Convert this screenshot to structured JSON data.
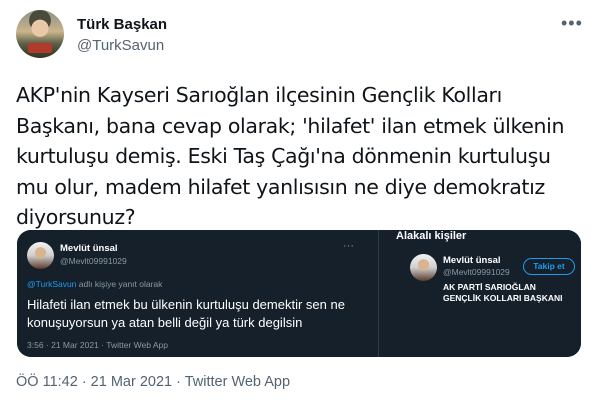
{
  "author": {
    "display_name": "Türk Başkan",
    "handle": "@TurkSavun",
    "more_icon": "more-horizontal-icon"
  },
  "tweet": {
    "text": "AKP'nin Kayseri Sarıoğlan ilçesinin Gençlik Kolları\nBaşkanı, bana cevap olarak;  'hilafet'  ilan etmek ülkenin\nkurtuluşu demiş.  Eski Taş Çağı'na dönmenin kurtuluşu\nmu olur, madem hilafet yanlısısın ne  diye demokratız\ndiyorsunuz?",
    "meta": "ÖÖ 11:42 · 21 Mar 2021 · Twitter Web App"
  },
  "screenshot": {
    "quoted": {
      "name": "Mevlüt ünsal",
      "handle": "@Mevlt09991029",
      "reply_mention": "@TurkSavun",
      "reply_suffix": " adlı kişiye yanıt olarak",
      "text": "Hilafeti ilan etmek bu ülkenin kurtuluşu demektir sen ne konuşuyorsun ya atan belli değil ya türk degilsin",
      "meta": "3:56 · 21 Mar 2021 · Twitter Web App"
    },
    "related": {
      "title": "Alakalı kişiler",
      "name": "Mevlüt ünsal",
      "handle": "@Mevlt09991029",
      "follow_label": "Takip et",
      "bio": "AK PARTİ SARIOĞLAN GENÇLİK KOLLARI BAŞKANI"
    }
  },
  "colors": {
    "accent": "#1d9bf0",
    "dark_bg": "#15202b",
    "muted": "#536471"
  }
}
